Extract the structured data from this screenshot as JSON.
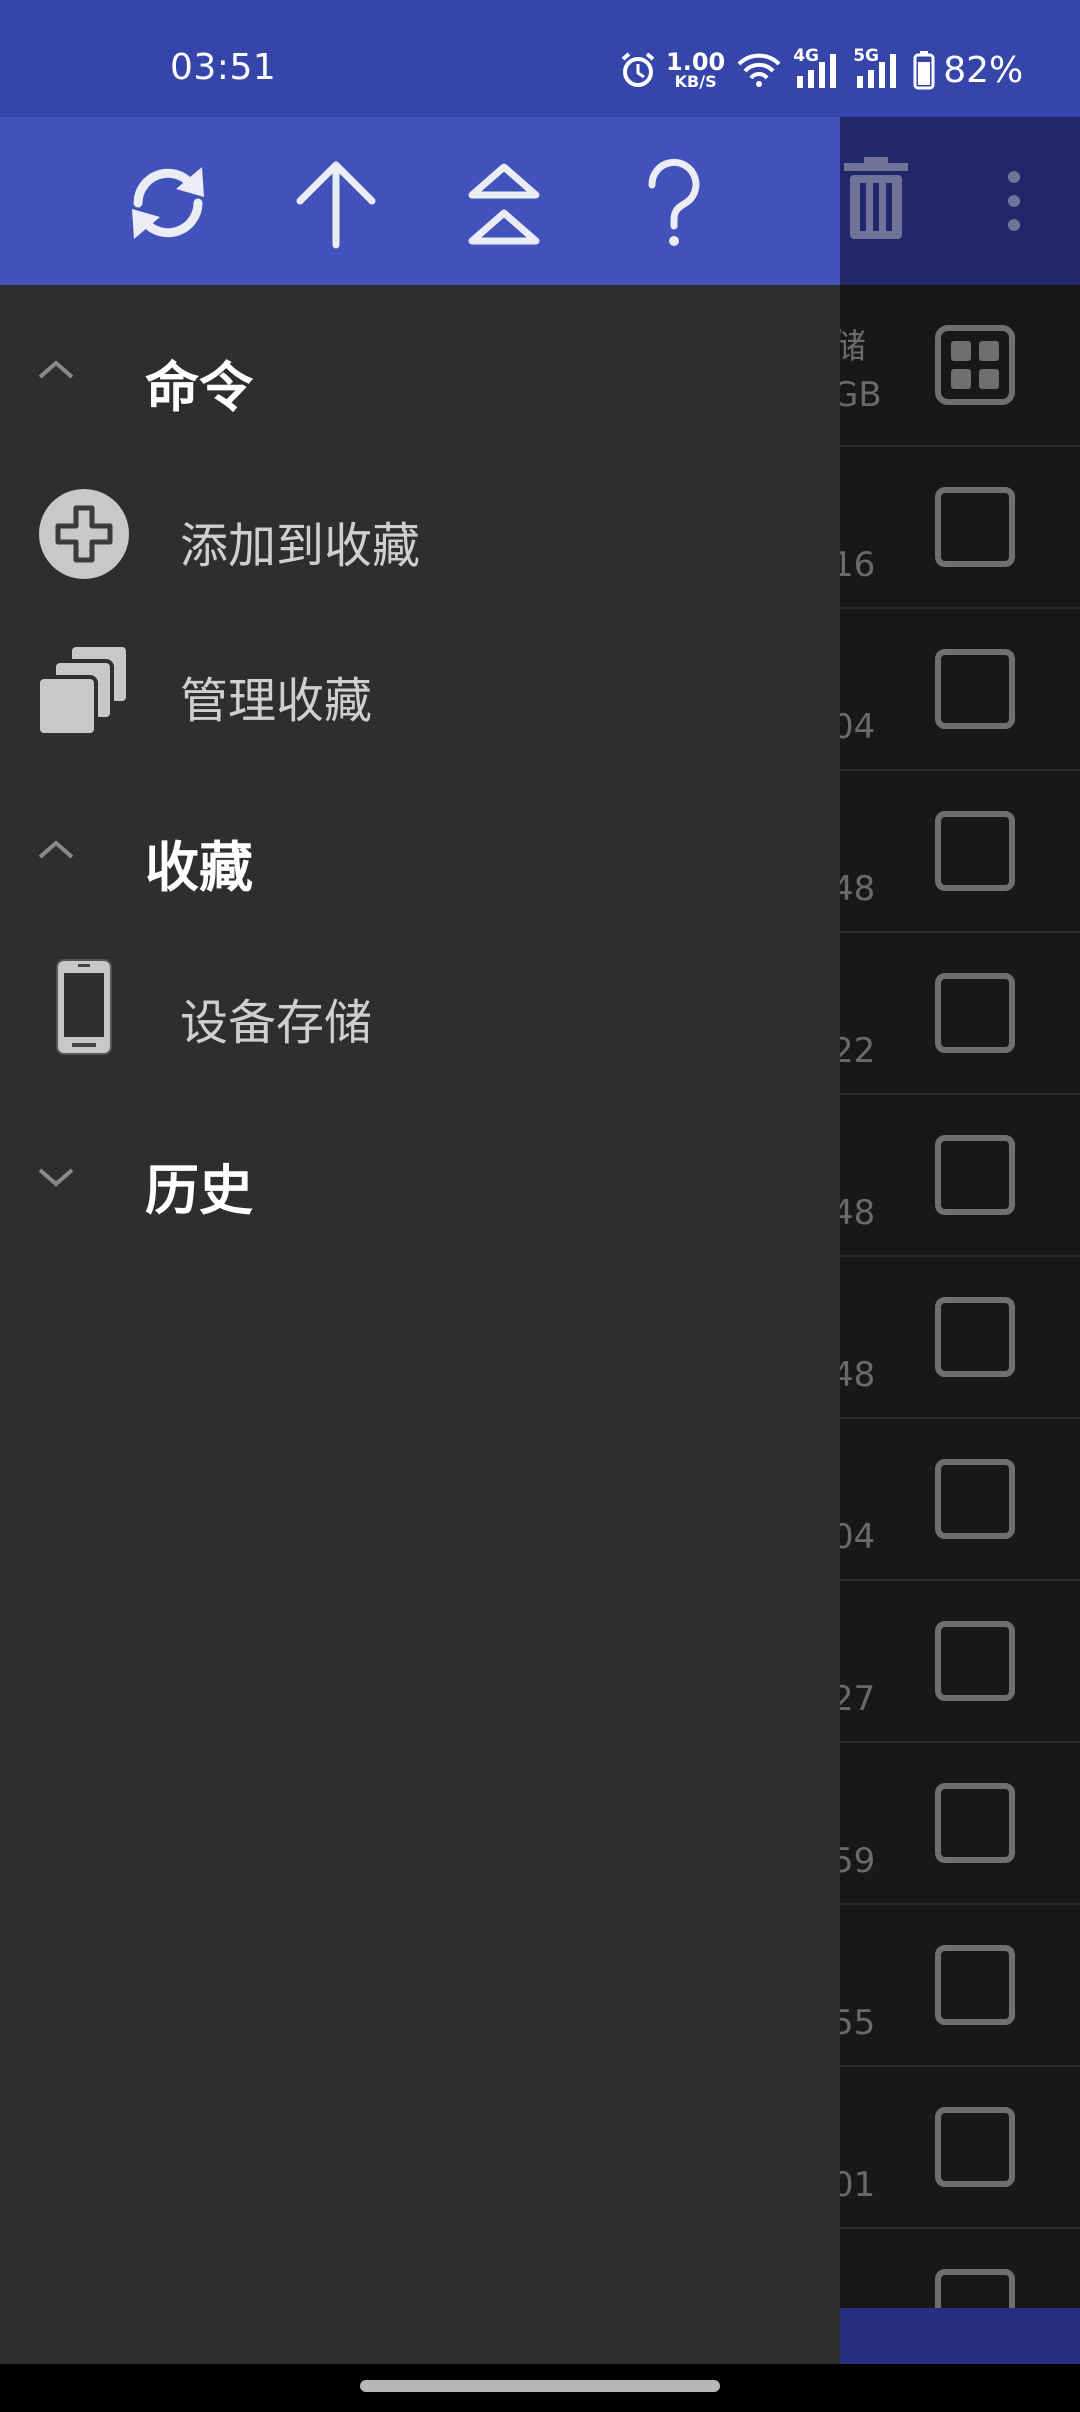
{
  "status_bar": {
    "time": "03:51",
    "net_speed_value": "1.00",
    "net_speed_unit": "KB/S",
    "net_4g": "4G",
    "net_5g": "5G",
    "battery_percent": "82%",
    "icons": [
      "alarm-icon",
      "wifi-icon",
      "signal-4g-icon",
      "signal-5g-icon",
      "battery-icon"
    ]
  },
  "drawer": {
    "toolbar_icons": [
      "refresh-icon",
      "arrow-up-icon",
      "double-chevron-up-icon",
      "help-icon"
    ],
    "sections": {
      "commands": {
        "title": "命令",
        "expanded": true,
        "items": [
          {
            "label": "添加到收藏",
            "icon": "add-circle-icon"
          },
          {
            "label": "管理收藏",
            "icon": "copy-stack-icon"
          }
        ]
      },
      "favorites": {
        "title": "收藏",
        "expanded": true,
        "items": [
          {
            "label": "设备存储",
            "icon": "phone-icon"
          }
        ]
      },
      "history": {
        "title": "历史",
        "expanded": false
      }
    }
  },
  "background": {
    "toolbar_icons": [
      "trash-icon",
      "more-vert-icon"
    ],
    "first_row_fragments": [
      "储",
      "GB"
    ],
    "row_fragments": [
      "16",
      "04",
      "48",
      "22",
      "48",
      "48",
      "04",
      "27",
      "59",
      "55",
      "01"
    ]
  },
  "colors": {
    "status_bar": "#3545aa",
    "drawer_toolbar": "#4152bb",
    "drawer_bg": "#2e2e2e",
    "scrim_list": "#181818"
  }
}
